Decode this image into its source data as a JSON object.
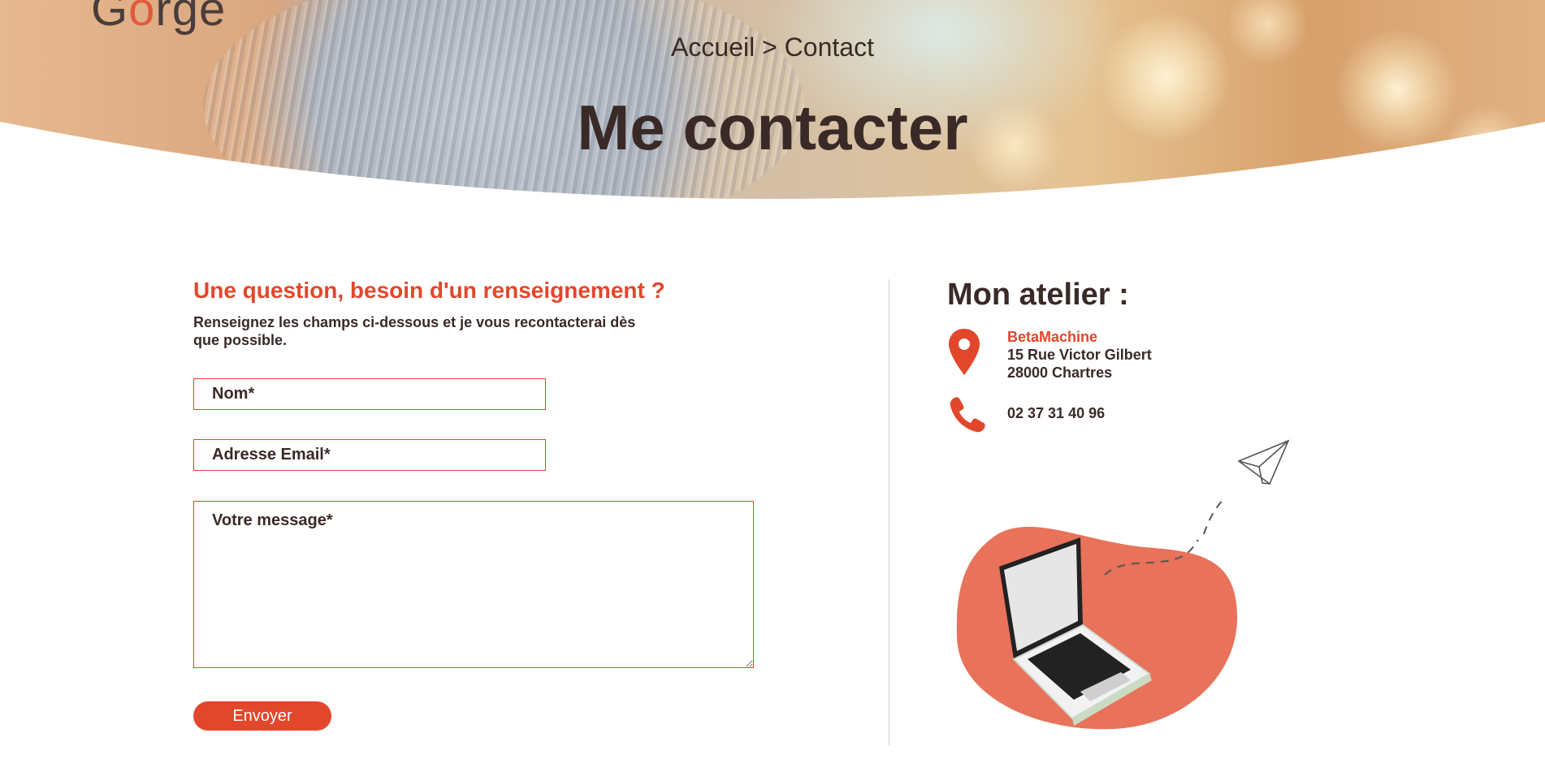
{
  "header": {
    "logo_text_start": "G",
    "logo_text_o": "o",
    "logo_text_end": "rge",
    "breadcrumb_home": "Accueil",
    "breadcrumb_separator": ">",
    "breadcrumb_current": "Contact",
    "page_title": "Me contacter"
  },
  "form": {
    "heading": "Une question, besoin d'un renseignement ?",
    "intro": "Renseignez les champs ci-dessous et je vous recontacterai dès que possible.",
    "name_placeholder": "Nom*",
    "email_placeholder": "Adresse Email*",
    "message_placeholder": "Votre message*",
    "submit_label": "Envoyer"
  },
  "atelier": {
    "title": "Mon atelier :",
    "company": "BetaMachine",
    "street": "15 Rue Victor Gilbert",
    "city": "28000 Chartres",
    "phone": "02 37 31 40 96"
  },
  "colors": {
    "accent": "#e2472b",
    "text": "#3a2a27",
    "blob": "#e8725a"
  },
  "icons": {
    "location": "map-pin-icon",
    "phone": "phone-icon",
    "illustration": "laptop-paper-plane-illustration"
  }
}
